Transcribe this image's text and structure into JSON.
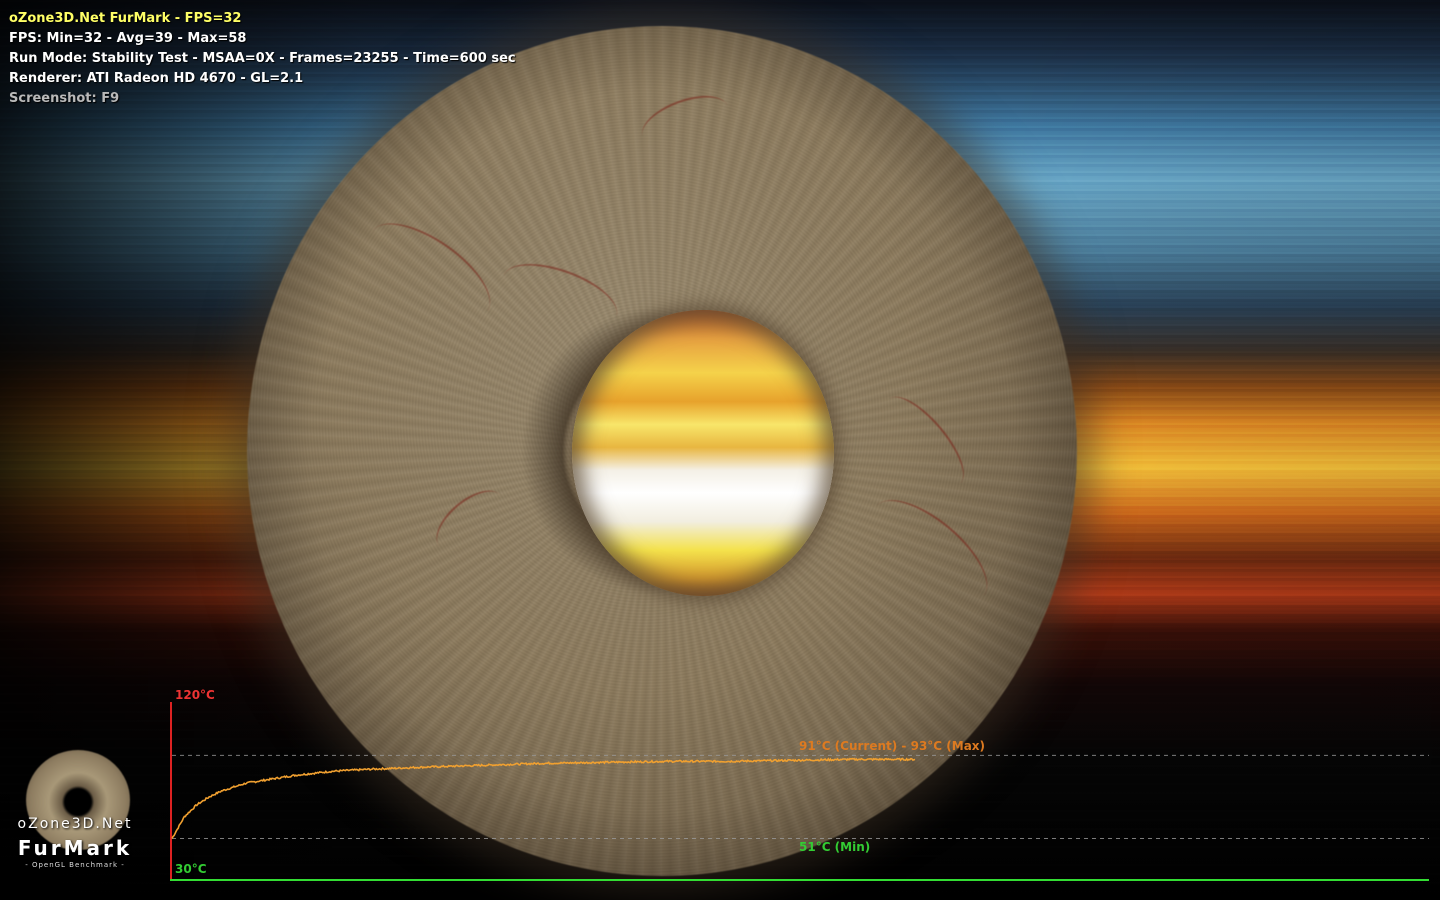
{
  "hud": {
    "title": "oZone3D.Net FurMark - FPS=32",
    "fps_stats": "FPS: Min=32 - Avg=39 - Max=58",
    "run_mode": "Run Mode: Stability Test - MSAA=0X - Frames=23255 - Time=600 sec",
    "renderer": "Renderer: ATI Radeon HD 4670 - GL=2.1",
    "screenshot_hint": "Screenshot: F9"
  },
  "logo": {
    "site": "oZone3D.Net",
    "product": "FurMark",
    "tagline": "- OpenGL Benchmark -"
  },
  "temperature_graph": {
    "max_label": "120°C",
    "min_label": "30°C",
    "current_label": "91°C (Current) - 93°C (Max)",
    "min_reading_label": "51°C (Min)",
    "colors": {
      "curve": "#f0a030",
      "axis_x": "#33dd33",
      "axis_y": "#dd2222",
      "max_label": "#ee3333",
      "min_label": "#33cc33",
      "current_label": "#dd7a20",
      "min_reading_label": "#33cc33"
    }
  },
  "chart_data": {
    "type": "line",
    "title": "",
    "xlabel": "",
    "ylabel": "",
    "ylim": [
      30,
      120
    ],
    "series": [
      {
        "name": "",
        "x": [
          0,
          10,
          20,
          30,
          40,
          50,
          60,
          80,
          100,
          130,
          160,
          200,
          250,
          300,
          350,
          400,
          450,
          500,
          550,
          600
        ],
        "values": [
          51,
          62,
          68,
          72,
          75,
          77,
          79,
          81,
          83,
          85,
          86,
          87,
          88,
          89,
          89.5,
          90,
          90,
          90.5,
          91,
          91
        ]
      }
    ],
    "reference_lines": [
      93,
      51
    ],
    "grid": false
  }
}
